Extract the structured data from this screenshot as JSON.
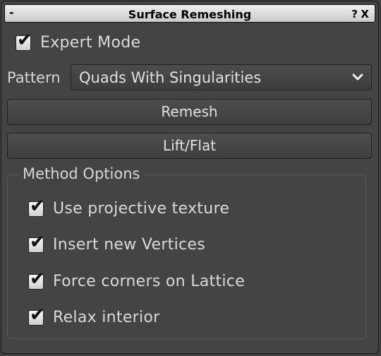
{
  "window": {
    "title": "Surface Remeshing",
    "minimize_glyph": "-",
    "help_glyph": "?",
    "close_glyph": "X"
  },
  "expert_mode": {
    "label": "Expert Mode",
    "checked": true
  },
  "pattern": {
    "label": "Pattern",
    "selected": "Quads With Singularities"
  },
  "buttons": {
    "remesh": "Remesh",
    "lift_flat": "Lift/Flat"
  },
  "method_options": {
    "title": "Method Options",
    "options": [
      {
        "label": "Use projective texture",
        "checked": true
      },
      {
        "label": "Insert new Vertices",
        "checked": true
      },
      {
        "label": "Force corners on Lattice",
        "checked": true
      },
      {
        "label": "Relax interior",
        "checked": true
      }
    ]
  },
  "icons": {
    "check": "checkmark-icon",
    "dropdown": "chevron-down-icon"
  },
  "colors": {
    "panel_bg": "#444444",
    "titlebar_bg": "#e0e0e0",
    "text": "#d6d6d6"
  }
}
